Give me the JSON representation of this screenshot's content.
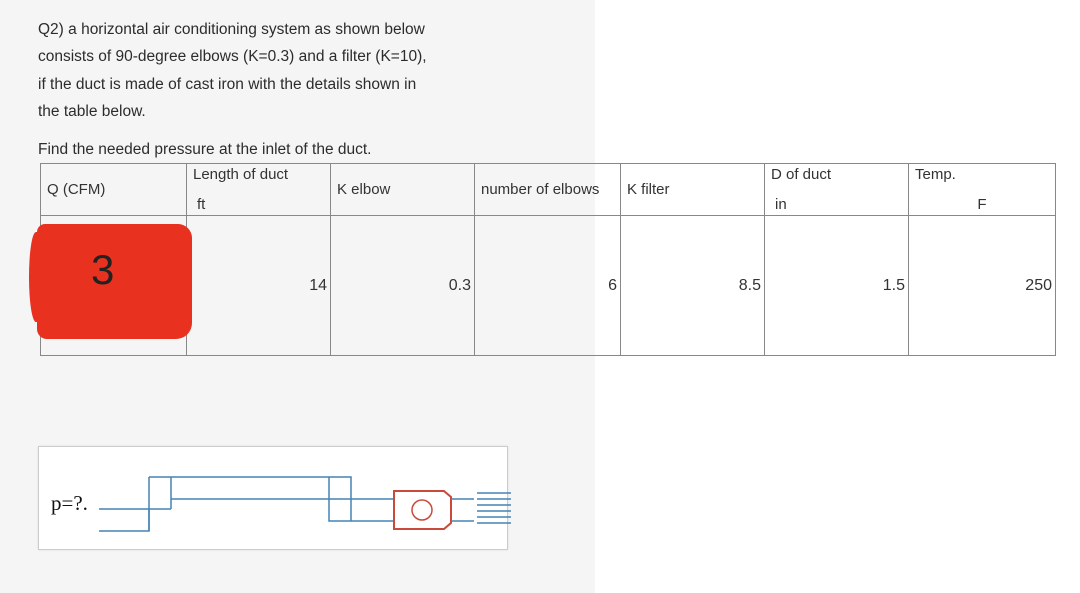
{
  "question": {
    "line1": "Q2) a horizontal air conditioning system as shown below",
    "line2": "consists of 90-degree elbows (K=0.3) and a filter (K=10),",
    "line3": "if the duct is made of cast iron with the details shown in",
    "line4": "the table below.",
    "find": "Find the needed pressure at the inlet of the duct."
  },
  "table": {
    "headers": {
      "q": "Q (CFM)",
      "length": "Length of duct",
      "length_unit": "ft",
      "kelbow": "K elbow",
      "nelbows": "number of elbows",
      "kfilter": "K filter",
      "dduct": "D of duct",
      "dduct_unit": "in",
      "temp": "Temp.",
      "temp_unit": "F"
    },
    "row": {
      "q": "3",
      "length": "14",
      "kelbow": "0.3",
      "nelbows": "6",
      "kfilter": "8.5",
      "dduct": "1.5",
      "temp": "250"
    }
  },
  "diagram": {
    "label": "p=?."
  }
}
